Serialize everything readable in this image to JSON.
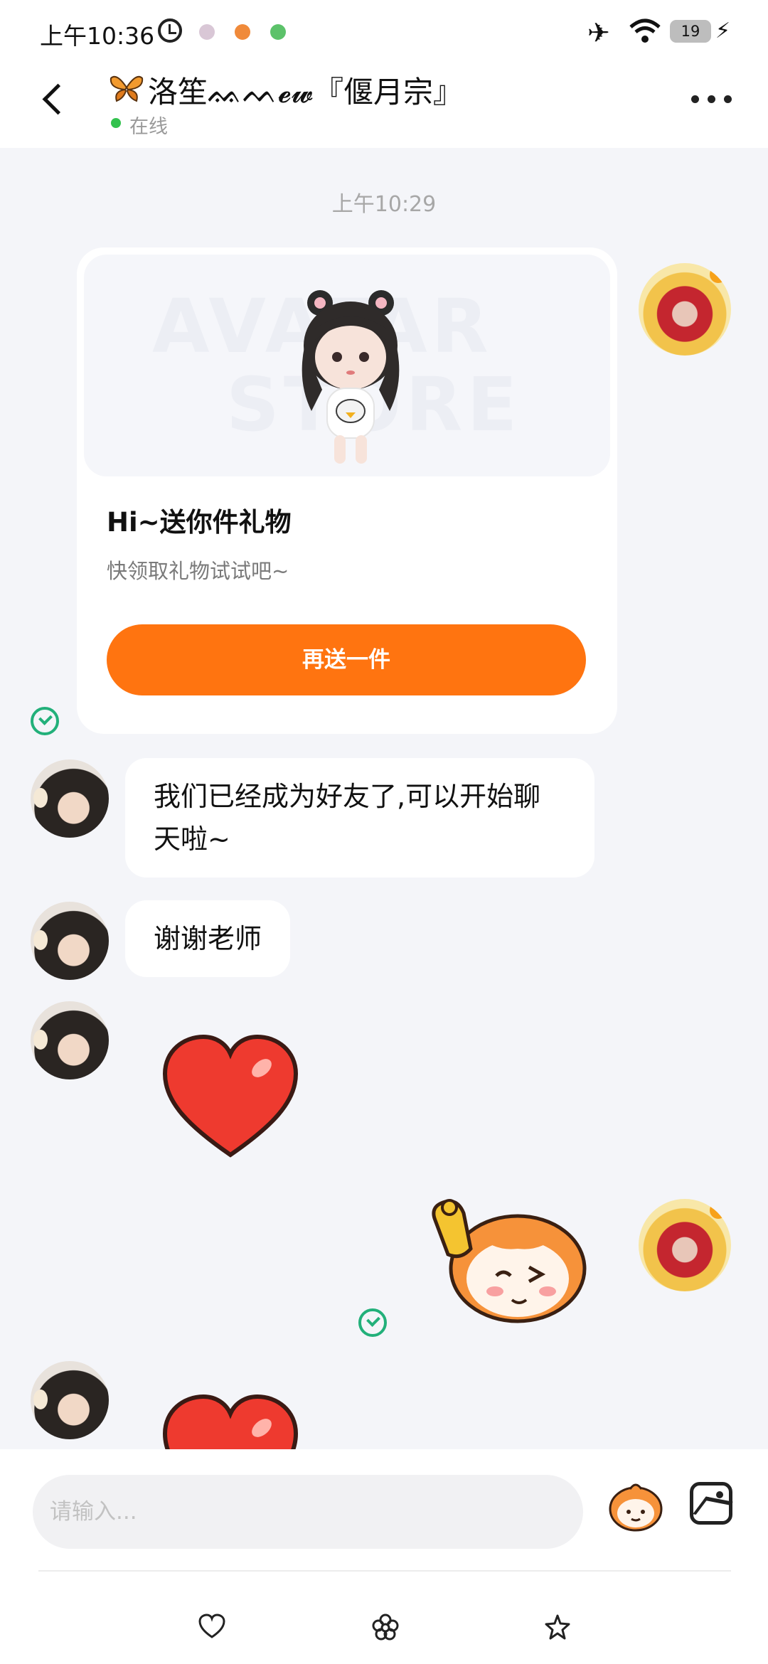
{
  "status_bar": {
    "time": "上午10:36",
    "battery": "19"
  },
  "header": {
    "title": "洛笙ᨐᨓ𝓮𝔀『偃月宗』",
    "status": "在线"
  },
  "conversation": {
    "timestamp": "上午10:29",
    "gift_card": {
      "banner_watermark_1": "AVATAR",
      "banner_watermark_2": "STORE",
      "title": "Hi~送你件礼物",
      "subtitle": "快领取礼物试试吧~",
      "button_label": "再送一件"
    },
    "messages": [
      {
        "text": "我们已经成为好友了,可以开始聊天啦~"
      },
      {
        "text": "谢谢老师"
      }
    ]
  },
  "input": {
    "placeholder": "请输入..."
  },
  "colors": {
    "accent": "#ff7410",
    "read": "#22b07a",
    "online": "#33c24e"
  },
  "icons": [
    "back-icon",
    "more-icon",
    "read-check-icon",
    "sticker-icon",
    "image-icon",
    "heart-icon",
    "flower-icon",
    "star-icon"
  ]
}
